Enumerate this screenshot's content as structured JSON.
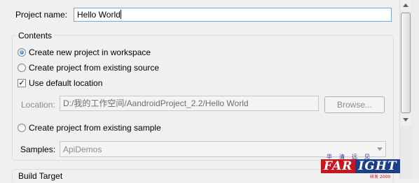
{
  "project": {
    "label": "Project name:",
    "value": "Hello World"
  },
  "contents": {
    "title": "Contents",
    "option_new": "Create new project in workspace",
    "option_existing_source": "Create project from existing source",
    "use_default_location": "Use default location",
    "location_label": "Location:",
    "location_value": "D:/我的工作空间/AandroidProject_2.2/Hello World",
    "browse_label": "Browse...",
    "option_existing_sample": "Create project from existing sample",
    "samples_label": "Samples:",
    "samples_value": "ApiDemos"
  },
  "build_target": {
    "title": "Build Target"
  },
  "watermark": {
    "top": "华清远见",
    "left": "FAR",
    "right": "IGHT",
    "bottom": "研发 2000"
  }
}
